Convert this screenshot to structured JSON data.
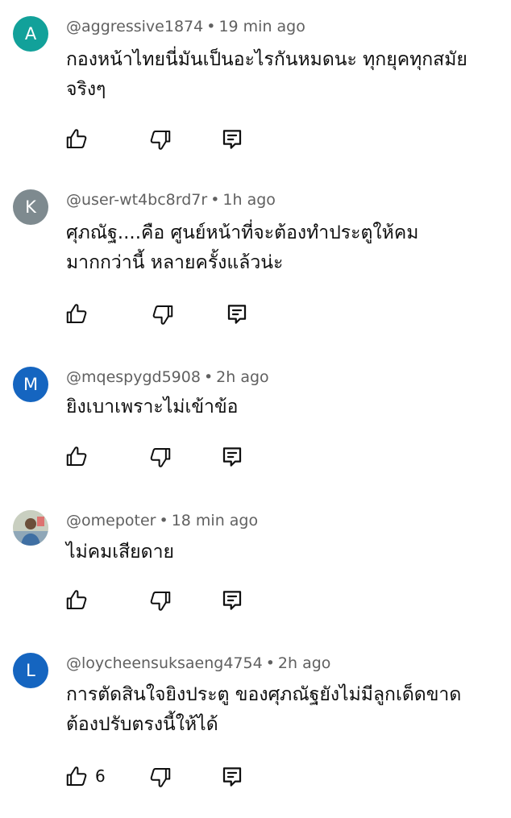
{
  "comments": [
    {
      "handle": "@aggressive1874",
      "time": "19 min ago",
      "avatar_letter": "A",
      "avatar_color": "#12a19a",
      "text": "กองหน้าไทยนี่มันเป็นอะไรกันหมดนะ ทุกยุคทุกสมัยจริงๆ",
      "likes": ""
    },
    {
      "handle": "@user-wt4bc8rd7r",
      "time": "1h ago",
      "avatar_letter": "K",
      "avatar_color": "#7e8a8f",
      "text": "ศุภณัฐ....คือ ศูนย์หน้าที่จะต้องทำประตูให้คมมากกว่านี้ หลายครั้งแล้วน่ะ",
      "likes": ""
    },
    {
      "handle": "@mqespygd5908",
      "time": "2h ago",
      "avatar_letter": "M",
      "avatar_color": "#1565c0",
      "text": "ยิงเบาเพราะไม่เข้าข้อ",
      "likes": ""
    },
    {
      "handle": "@omepoter",
      "time": "18 min ago",
      "avatar_letter": "",
      "avatar_color": "#cfd4c8",
      "text": "ไม่คมเสียดาย",
      "likes": ""
    },
    {
      "handle": "@loycheensuksaeng4754",
      "time": "2h ago",
      "avatar_letter": "L",
      "avatar_color": "#1565c0",
      "text": "การตัดสินใจยิงประตู ของศุภณัฐยังไม่มีลูกเด็ดขาด ต้องปรับตรงนี้ให้ได้",
      "likes": "6"
    }
  ],
  "icons": {
    "like": "thumbs-up-icon",
    "dislike": "thumbs-down-icon",
    "reply": "reply-icon"
  },
  "meta_separator": "•"
}
